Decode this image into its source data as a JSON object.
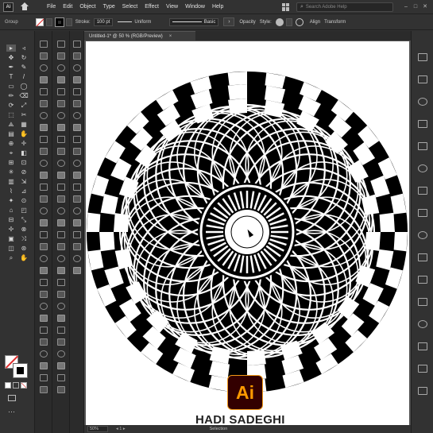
{
  "app": {
    "icon_text": "Ai"
  },
  "menu": [
    "File",
    "Edit",
    "Object",
    "Type",
    "Select",
    "Effect",
    "View",
    "Window",
    "Help"
  ],
  "search": {
    "placeholder": "Search Adobe Help"
  },
  "control_bar": {
    "label": "Group",
    "stroke_label": "Stroke:",
    "stroke_value": "100 pt",
    "profile": "Uniform",
    "brush": "Basic",
    "opacity_label": "Opacity",
    "style_label": "Style:",
    "align_label": "Align",
    "transform_label": "Transform"
  },
  "document": {
    "tab_title": "Untitled-1* @ 50 % (RGB/Preview)",
    "tab_close": "×"
  },
  "watermark": {
    "logo_text": "Ai",
    "author": "HADI SADEGHI"
  },
  "status": {
    "zoom": "50%",
    "nav": "◂  1  ▸",
    "mode": "Selection"
  },
  "tools": [
    "▸",
    "◃",
    "✥",
    "↻",
    "✒",
    "✎",
    "T",
    "/",
    "▭",
    "◯",
    "✏",
    "⌫",
    "⟳",
    "⤢",
    "⬚",
    "✂",
    "⟁",
    "▦",
    "▤",
    "✋",
    "⊕",
    "✛",
    "⌖",
    "◧",
    "⊞",
    "⊡",
    "✳",
    "⊘",
    "▥",
    "⇲",
    "⌇",
    "⊿",
    "✦",
    "⊙",
    "⌂",
    "◰",
    "⊟",
    "⤡",
    "✢",
    "⊗",
    "▣",
    "⤨",
    "◫",
    "⊛",
    "⌕",
    "✋"
  ]
}
